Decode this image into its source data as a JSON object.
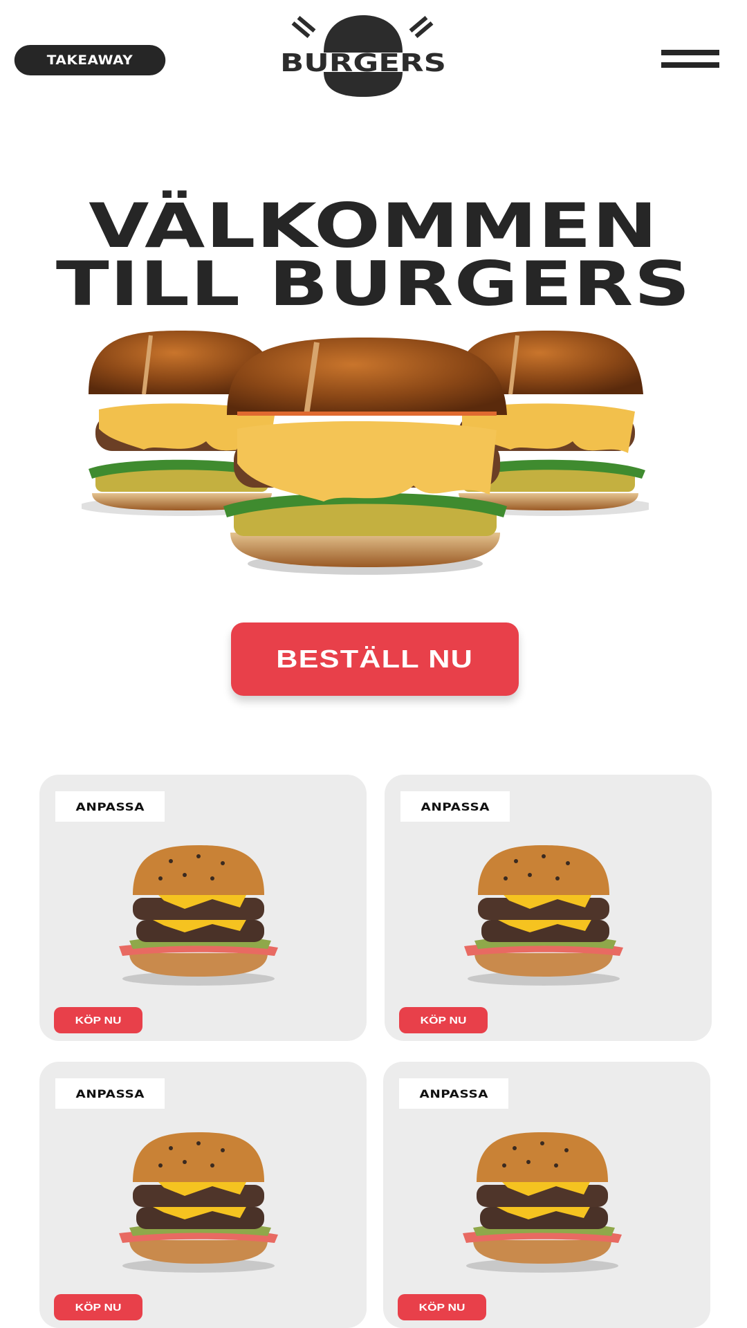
{
  "header": {
    "takeaway_label": "TAKEAWAY",
    "logo_text": "BURGERS",
    "menu_icon": "hamburger-menu-icon"
  },
  "hero": {
    "title_line1": "VÄLKOMMEN",
    "title_line2": "TILL BURGERS",
    "order_label": "BESTÄLL NU"
  },
  "products": [
    {
      "tag": "ANPASSA",
      "buy_label": "KÖP NU"
    },
    {
      "tag": "ANPASSA",
      "buy_label": "KÖP NU"
    },
    {
      "tag": "ANPASSA",
      "buy_label": "KÖP NU"
    },
    {
      "tag": "ANPASSA",
      "buy_label": "KÖP NU"
    }
  ],
  "colors": {
    "accent": "#e8404a",
    "dark": "#262626",
    "card_bg": "#ececec"
  }
}
